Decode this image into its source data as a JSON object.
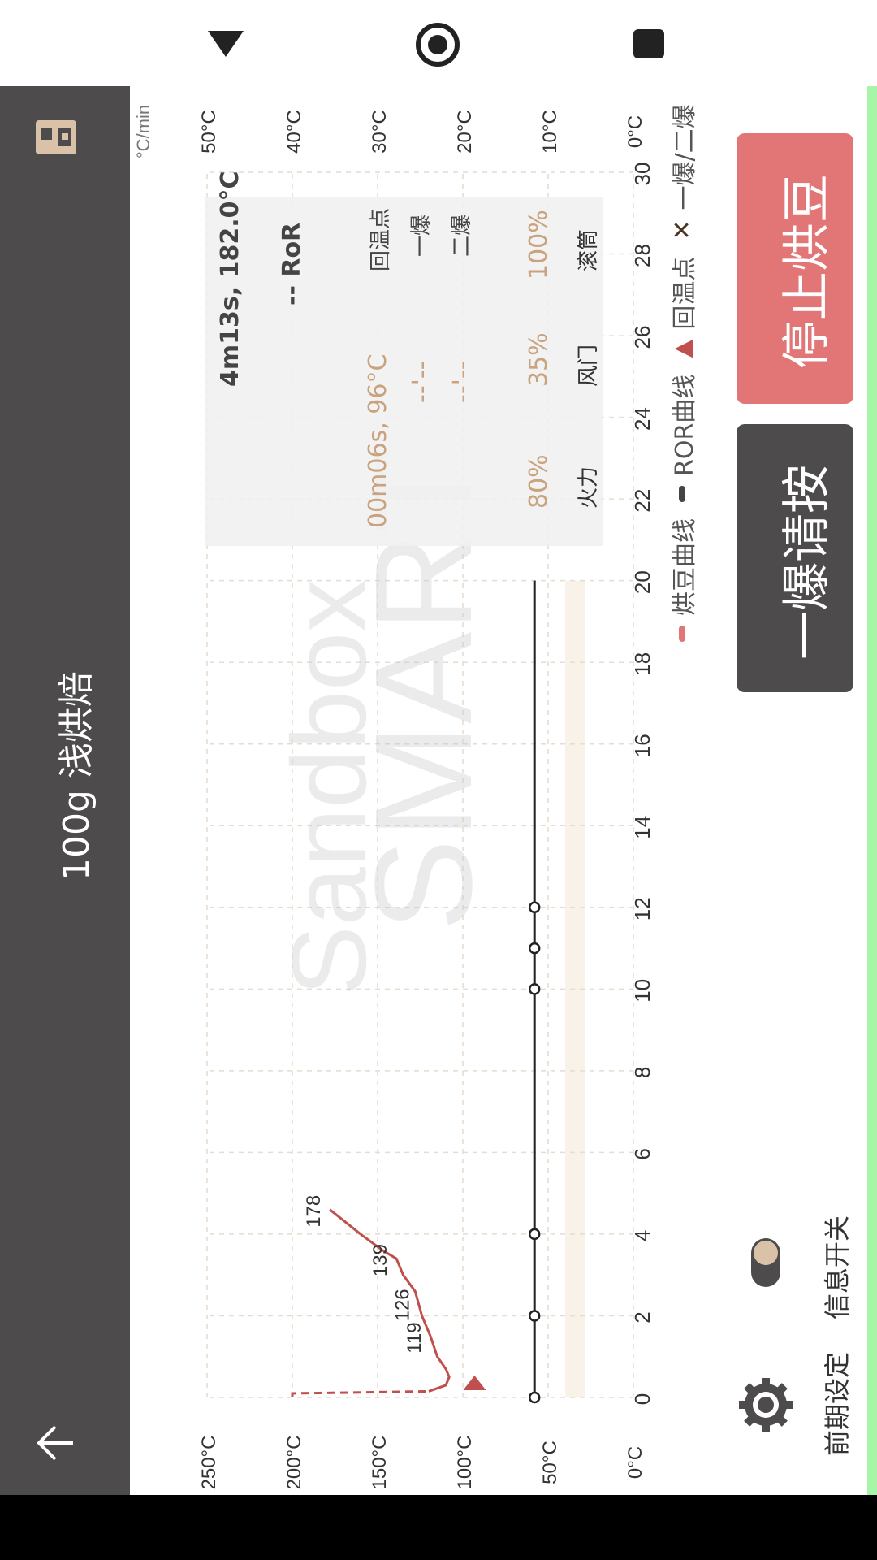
{
  "app": {
    "title": "100g 浅烘焙"
  },
  "chart": {
    "ror_unit": "°C/min",
    "left_axis_ticks": [
      "250°C",
      "200°C",
      "150°C",
      "100°C",
      "50°C",
      "0°C"
    ],
    "right_axis_ticks": [
      "50°C",
      "40°C",
      "30°C",
      "20°C",
      "10°C",
      "0°C"
    ],
    "time_ticks": [
      "0",
      "2",
      "4",
      "6",
      "8",
      "10",
      "12",
      "14",
      "16",
      "18",
      "20",
      "22",
      "24",
      "26",
      "28",
      "30"
    ],
    "point_labels": [
      "119",
      "126",
      "139",
      "178"
    ],
    "watermark_line1": "Sandbox",
    "watermark_line2": "SMART"
  },
  "chart_data": {
    "type": "line",
    "xlim": [
      0,
      30
    ],
    "ylim": [
      0,
      250
    ],
    "y2lim": [
      0,
      50
    ],
    "series": [
      {
        "name": "烘豆曲线",
        "color": "#c0504d",
        "points": [
          [
            0.0,
            200
          ],
          [
            0.1,
            200
          ],
          [
            0.15,
            120
          ],
          [
            0.3,
            110
          ],
          [
            0.5,
            108
          ],
          [
            0.7,
            110
          ],
          [
            1.0,
            115
          ],
          [
            1.5,
            119
          ],
          [
            2.0,
            124
          ],
          [
            2.3,
            126
          ],
          [
            2.6,
            128
          ],
          [
            3.0,
            135
          ],
          [
            3.4,
            139
          ],
          [
            3.6,
            147
          ],
          [
            4.0,
            160
          ],
          [
            4.4,
            172
          ],
          [
            4.6,
            178
          ]
        ]
      },
      {
        "name": "ROR曲线",
        "values": []
      }
    ],
    "turning_point": {
      "x": 0.1,
      "y": 96
    },
    "control_line": {
      "x": [
        0,
        20
      ],
      "y": 58,
      "markers_x": [
        0,
        2,
        4,
        10,
        11,
        12
      ]
    }
  },
  "info": {
    "current": "4m13s, 182.0°C",
    "ror_label": "-- RoR",
    "turn_label": "回温点",
    "turn_value": "00m06s, 96°C",
    "first_label": "一爆",
    "first_value": "--'--",
    "second_label": "二爆",
    "second_value": "--'--",
    "fire_value": "80%",
    "fire_label": "火力",
    "damper_value": "35%",
    "damper_label": "风门",
    "drum_value": "100%",
    "drum_label": "滚筒"
  },
  "legend": {
    "roast": "烘豆曲线",
    "ror": "ROR曲线",
    "turn": "回温点",
    "crack": "一爆/二爆"
  },
  "buttons": {
    "stop": "停止烘豆",
    "first_crack": "一爆请按"
  },
  "settings": {
    "preset_label": "前期设定",
    "info_switch_label": "信息开关"
  },
  "colors": {
    "roast_curve": "#c0504d",
    "stop_button": "#e27575",
    "app_bar": "#4d4b4c",
    "accent": "#c9a27e"
  }
}
